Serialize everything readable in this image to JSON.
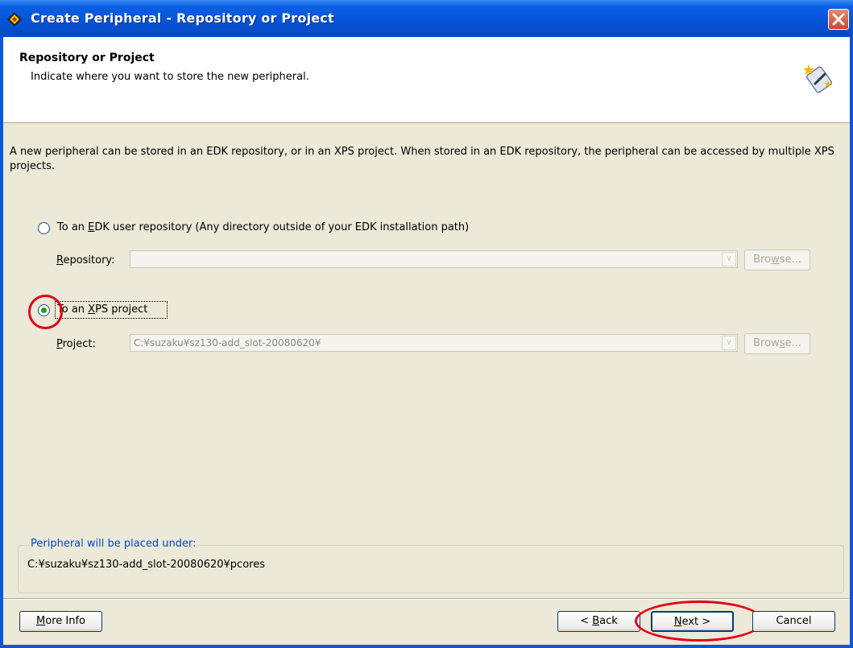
{
  "window": {
    "title": "Create Peripheral - Repository or Project",
    "colors": {
      "titlebar": "#0553d6",
      "client": "#ece9d8",
      "annotation": "#e2001a",
      "group_legend": "#0046d5"
    }
  },
  "header": {
    "title": "Repository or Project",
    "subtitle": "Indicate where you want to store the new peripheral."
  },
  "description": "A new peripheral can be stored in an EDK repository, or in an XPS project. When stored in an EDK repository, the peripheral can be accessed by multiple XPS projects.",
  "options": {
    "edk": {
      "label_pre": "To an ",
      "label_mnemonic": "E",
      "label_post": "DK user repository (Any directory outside of your EDK installation path)",
      "selected": false,
      "field_label_mnemonic": "R",
      "field_label_rest": "epository:",
      "value": "",
      "browse_pre": "Bro",
      "browse_mnemonic": "w",
      "browse_post": "se...",
      "enabled": false
    },
    "xps": {
      "label_pre": "To an ",
      "label_mnemonic": "X",
      "label_post": "PS project",
      "selected": true,
      "field_label_mnemonic": "P",
      "field_label_rest": "roject:",
      "value": "C:¥suzaku¥sz130-add_slot-20080620¥",
      "browse_pre": "Brow",
      "browse_mnemonic": "s",
      "browse_post": "e...",
      "enabled": false
    }
  },
  "placement": {
    "legend": "Peripheral will be placed under:",
    "path": "C:¥suzaku¥sz130-add_slot-20080620¥pcores"
  },
  "footer": {
    "more_info_mnemonic": "M",
    "more_info_rest": "ore Info",
    "back_prefix": "< ",
    "back_mnemonic": "B",
    "back_rest": "ack",
    "next_mnemonic": "N",
    "next_rest": "ext >",
    "cancel": "Cancel"
  },
  "icons": [
    "app-logo-icon",
    "close-icon",
    "wizard-icon",
    "dropdown-arrow-icon"
  ]
}
